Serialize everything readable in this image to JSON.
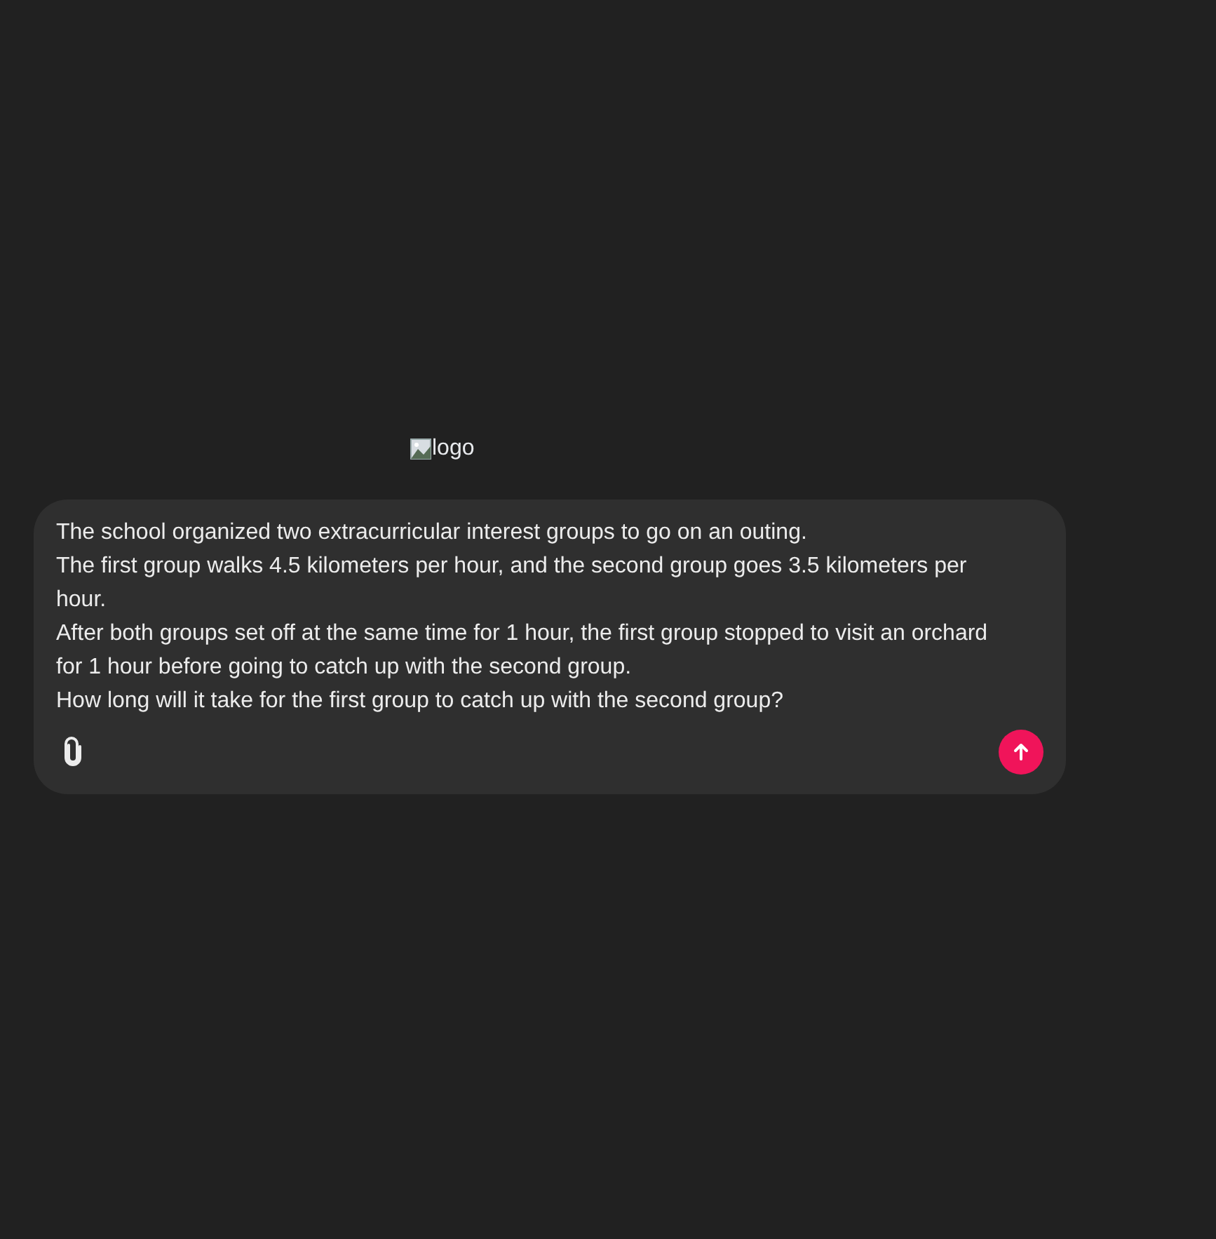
{
  "logo": {
    "alt": "logo"
  },
  "composer": {
    "value": "The school organized two extracurricular interest groups to go on an outing.\nThe first group walks 4.5 kilometers per hour, and the second group goes 3.5 kilometers per hour.\nAfter both groups set off at the same time for 1 hour, the first group stopped to visit an orchard for 1 hour before going to catch up with the second group.\nHow long will it take for the first group to catch up with the second group?"
  }
}
